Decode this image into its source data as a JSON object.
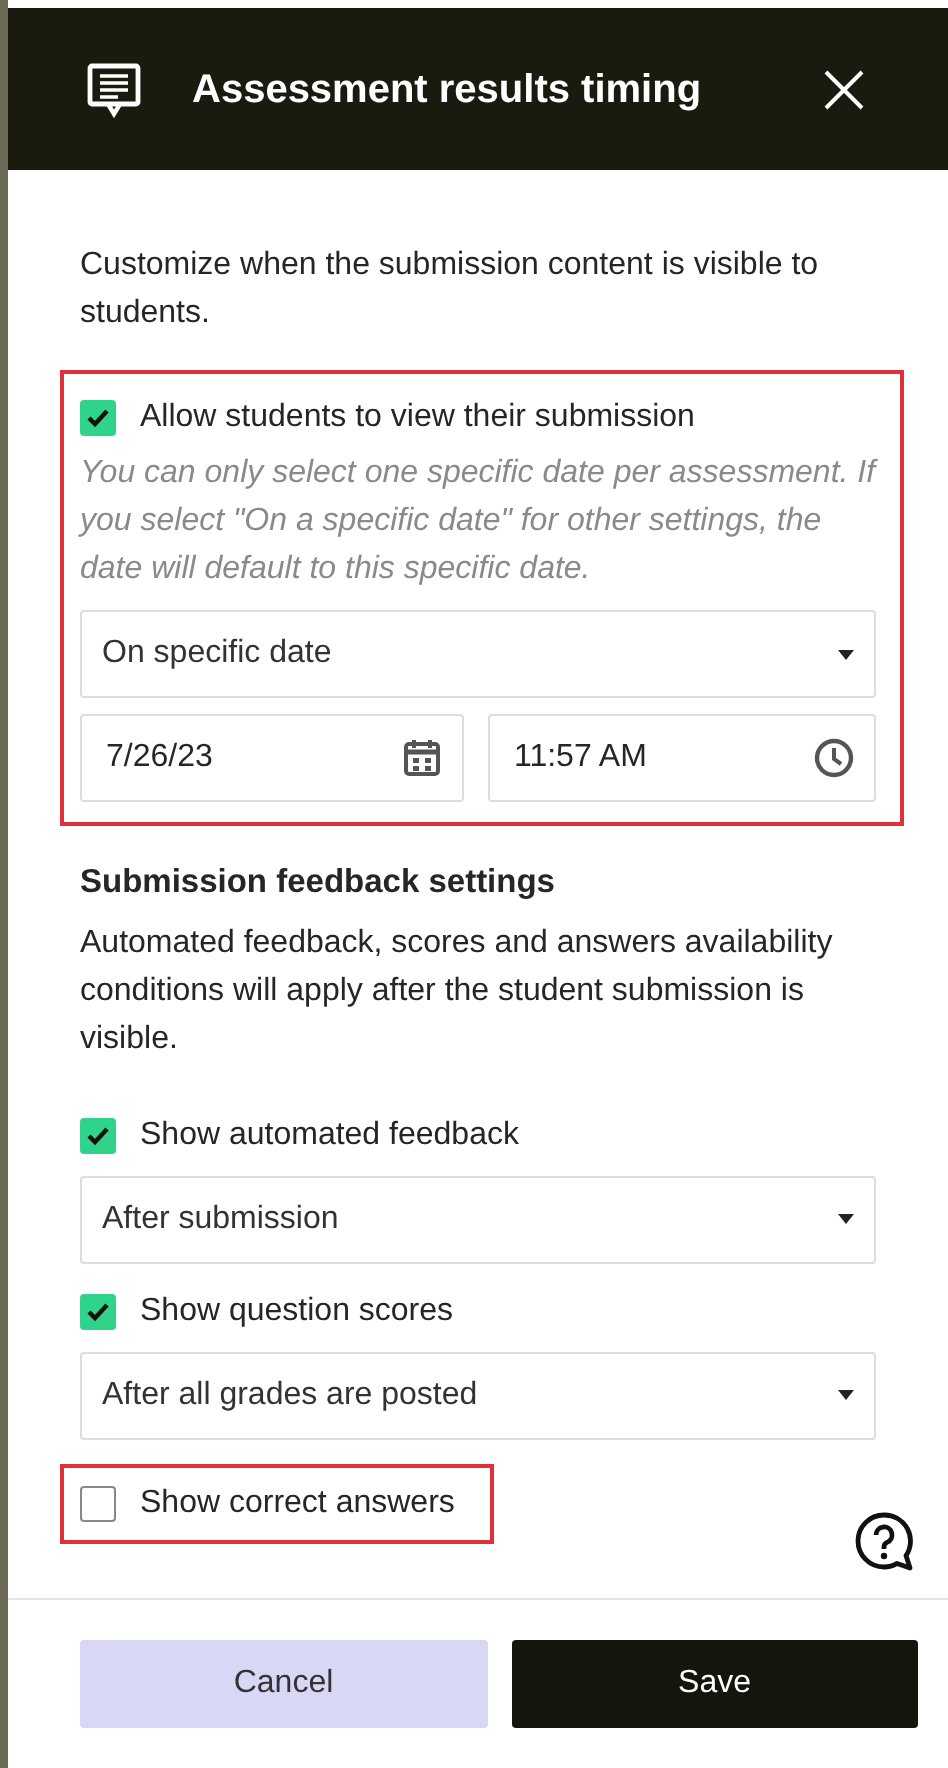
{
  "panel": {
    "title": "Assessment results timing"
  },
  "intro": "Customize when the submission content is visible to students.",
  "visibility": {
    "highlighted": true,
    "checkbox": {
      "label": "Allow students to view their submission",
      "checked": true
    },
    "note": "You can only select one specific date per assessment. If you select \"On a specific date\" for other settings, the date will default to this specific date.",
    "select": {
      "value": "On specific date"
    },
    "date": {
      "value": "7/26/23"
    },
    "time": {
      "value": "11:57 AM"
    }
  },
  "feedback": {
    "heading": "Submission feedback settings",
    "description": "Automated feedback, scores and answers availability conditions will apply after the student submission is visible.",
    "options": [
      {
        "label": "Show automated feedback",
        "checked": true,
        "highlighted": false,
        "select": {
          "value": "After submission"
        }
      },
      {
        "label": "Show question scores",
        "checked": true,
        "highlighted": false,
        "select": {
          "value": "After all grades are posted"
        }
      },
      {
        "label": "Show correct answers",
        "checked": false,
        "highlighted": true
      }
    ]
  },
  "buttons": [
    {
      "label": "Cancel",
      "kind": "secondary"
    },
    {
      "label": "Save",
      "kind": "primary"
    }
  ]
}
